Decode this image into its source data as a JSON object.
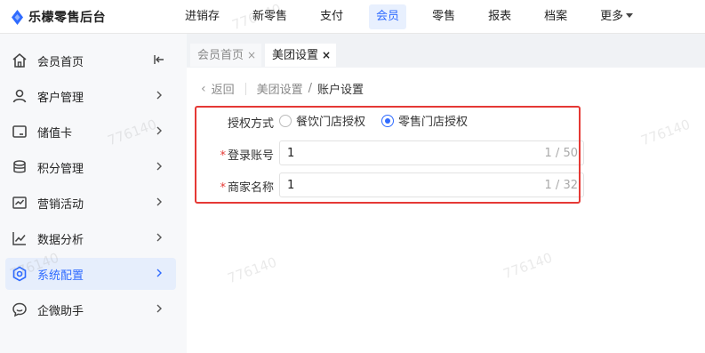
{
  "app": {
    "logo_text": "乐檬零售后台",
    "accent": "#2f6bff"
  },
  "nav": {
    "items": [
      {
        "label": "进销存",
        "active": false
      },
      {
        "label": "新零售",
        "active": false
      },
      {
        "label": "支付",
        "active": false
      },
      {
        "label": "会员",
        "active": true
      },
      {
        "label": "零售",
        "active": false
      },
      {
        "label": "报表",
        "active": false
      },
      {
        "label": "档案",
        "active": false
      },
      {
        "label": "更多",
        "active": false,
        "dropdown": true
      }
    ]
  },
  "sidebar": {
    "collapse_icon": "collapse-left-icon",
    "items": [
      {
        "label": "会员首页",
        "icon": "home-icon"
      },
      {
        "label": "客户管理",
        "icon": "user-icon"
      },
      {
        "label": "储值卡",
        "icon": "card-icon"
      },
      {
        "label": "积分管理",
        "icon": "coins-icon"
      },
      {
        "label": "营销活动",
        "icon": "chart-board-icon"
      },
      {
        "label": "数据分析",
        "icon": "trend-icon"
      },
      {
        "label": "系统配置",
        "icon": "hexagon-gear-icon",
        "active": true
      },
      {
        "label": "企微助手",
        "icon": "chat-bubble-icon"
      }
    ]
  },
  "tabs": [
    {
      "label": "会员首页",
      "close": "×",
      "active": false
    },
    {
      "label": "美团设置",
      "close": "×",
      "active": true
    }
  ],
  "breadcrumb": {
    "back": "返回",
    "parent": "美团设置",
    "separator": "/",
    "current": "账户设置"
  },
  "form": {
    "auth_label": "授权方式",
    "auth_options": [
      {
        "label": "餐饮门店授权",
        "checked": false
      },
      {
        "label": "零售门店授权",
        "checked": true
      }
    ],
    "account": {
      "label": "登录账号",
      "value": "1",
      "counter": "1 / 50"
    },
    "merchant": {
      "label": "商家名称",
      "value": "1",
      "counter": "1 / 32"
    }
  },
  "watermark": "776140"
}
